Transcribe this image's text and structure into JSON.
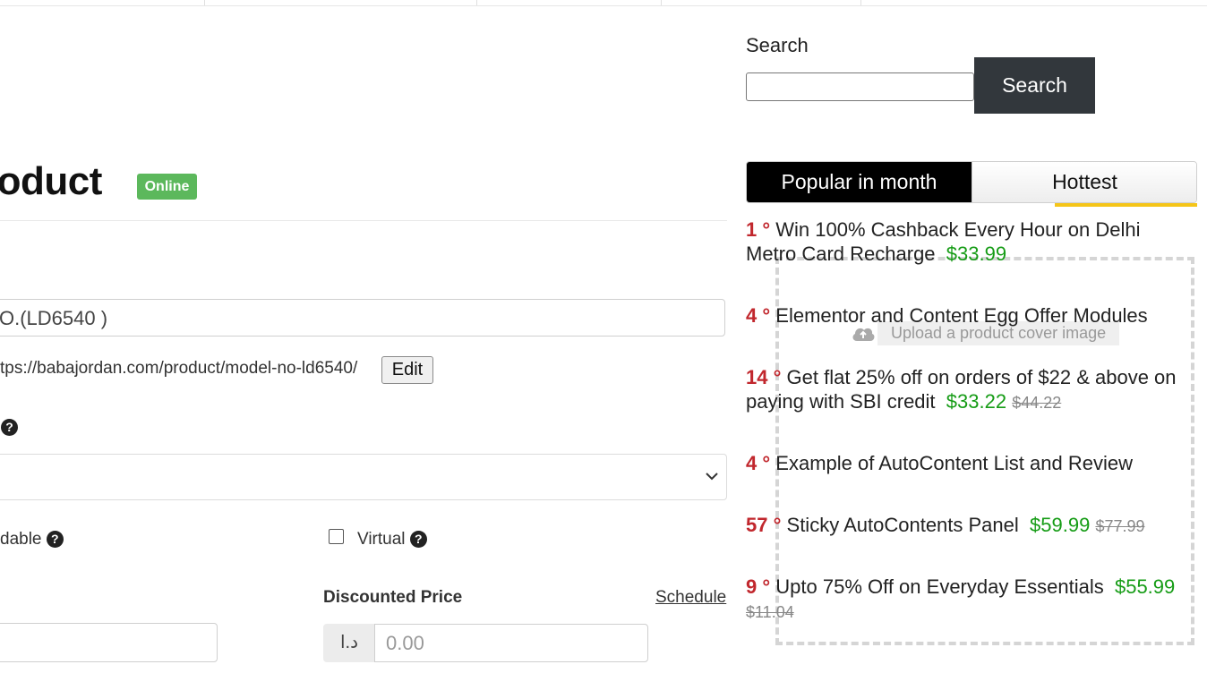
{
  "product": {
    "title": "roduct",
    "status_badge": "Online",
    "name_value": "O.(LD6540 )",
    "permalink": "tps://babajordan.com/product/model-no-ld6540/",
    "edit_label": "Edit",
    "downloadable_label": "dable",
    "virtual_label": "Virtual",
    "discounted_price_label": "Discounted Price",
    "schedule_label": "Schedule",
    "currency_symbol": "د.ا",
    "discounted_price_placeholder": "0.00"
  },
  "sidebar": {
    "search_label": "Search",
    "search_button": "Search",
    "tabs": [
      {
        "label": "Popular in month",
        "active": true
      },
      {
        "label": "Hottest",
        "active": false
      }
    ],
    "upload_hint": "Upload a product cover image",
    "deals": [
      {
        "rank": "1",
        "title": "Win 100% Cashback Every Hour on Delhi Metro Card Recharge",
        "price": "$33.99",
        "old_price": ""
      },
      {
        "rank": "4",
        "title": "Elementor and Content Egg Offer Modules",
        "price": "",
        "old_price": ""
      },
      {
        "rank": "14",
        "title": "Get flat 25% off on orders of $22 & above on paying with SBI credit",
        "price": "$33.22",
        "old_price": "$44.22"
      },
      {
        "rank": "4",
        "title": "Example of AutoContent List and Review",
        "price": "",
        "old_price": ""
      },
      {
        "rank": "57",
        "title": "Sticky AutoContents Panel",
        "price": "$59.99",
        "old_price": "$77.99"
      },
      {
        "rank": "9",
        "title": "Upto 75% Off on Everyday Essentials",
        "price": "$55.99",
        "old_price": "$11.04"
      }
    ]
  },
  "icons": {
    "help": "question-circle-icon",
    "chevron": "chevron-down-icon",
    "upload": "cloud-upload-icon"
  },
  "colors": {
    "badge_green": "#5cb85c",
    "search_button_bg": "#32373c",
    "rank_red": "#c1272d",
    "price_green": "#169c16",
    "tab_accent": "#f5c518"
  }
}
